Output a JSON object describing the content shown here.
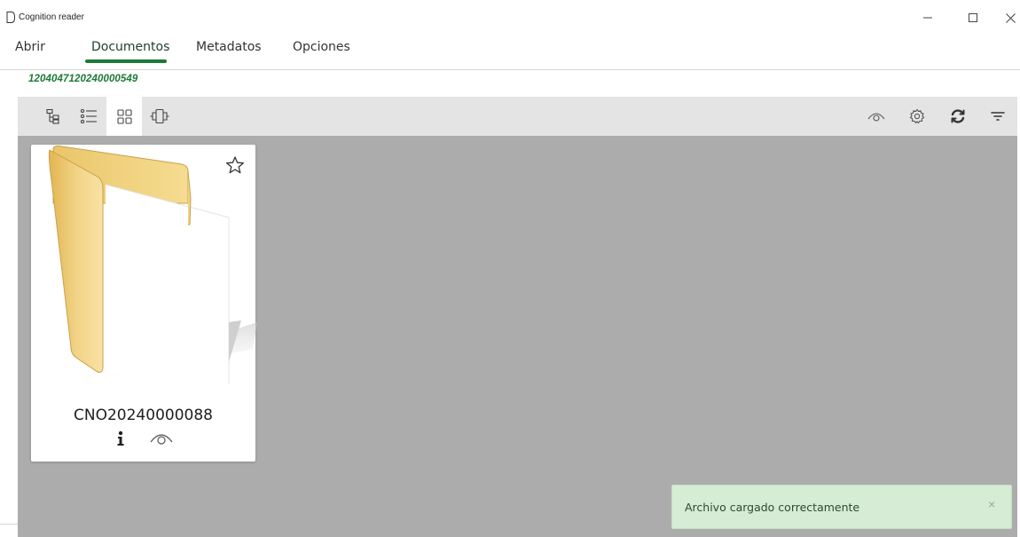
{
  "window": {
    "title": "Cognition reader",
    "minimize_icon": "minimize-icon",
    "maximize_icon": "maximize-icon",
    "close_icon": "close-icon"
  },
  "tabs": [
    {
      "label": "Abrir",
      "active": false
    },
    {
      "label": "Documentos",
      "active": true
    },
    {
      "label": "Metadatos",
      "active": false
    },
    {
      "label": "Opciones",
      "active": false
    }
  ],
  "record_id": "1204047120240000549",
  "toolbar": {
    "view_buttons": [
      "tree-view-icon",
      "list-view-icon",
      "grid-view-icon",
      "carousel-view-icon"
    ],
    "active_view": "grid-view-icon",
    "right_buttons": [
      "eye-icon",
      "settings-icon",
      "refresh-icon",
      "filter-icon"
    ]
  },
  "documents": [
    {
      "name": "CNO20240000088",
      "starred": false,
      "icon": "folder-icon"
    }
  ],
  "toast": {
    "message": "Archivo cargado correctamente",
    "close_label": "×"
  },
  "colors": {
    "accent": "#1c7a36",
    "content_bg": "#acacac",
    "toolbar_bg": "#e4e4e4",
    "toast_bg": "#d6ecd4"
  }
}
